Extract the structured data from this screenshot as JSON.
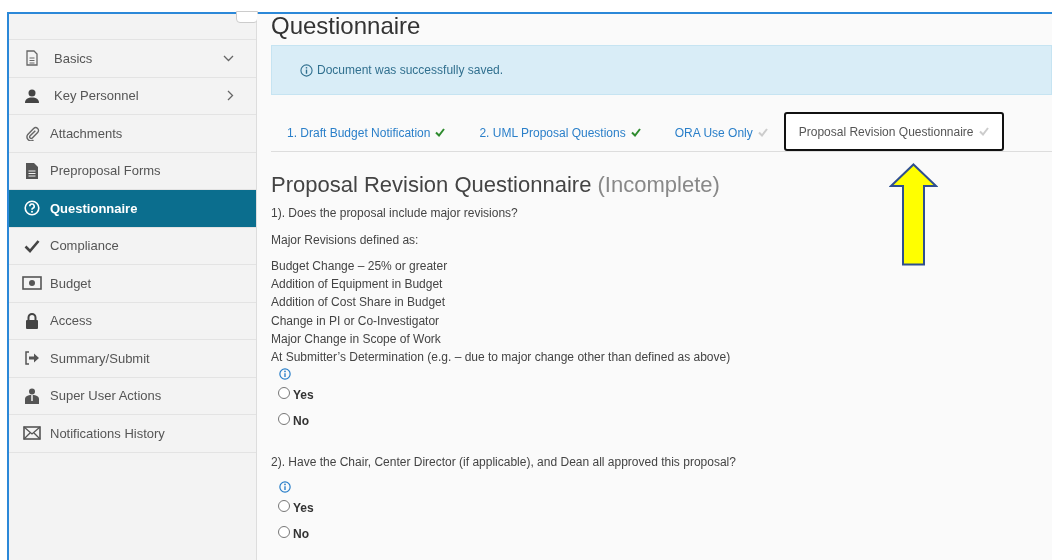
{
  "sidebar": {
    "items": [
      {
        "label": "Basics",
        "kind": "group",
        "expanded": true,
        "selected": false
      },
      {
        "label": "Key Personnel",
        "kind": "group",
        "expanded": false,
        "selected": false
      },
      {
        "label": "Attachments",
        "kind": "link",
        "selected": false
      },
      {
        "label": "Preproposal Forms",
        "kind": "link",
        "selected": false
      },
      {
        "label": "Questionnaire",
        "kind": "link",
        "selected": true
      },
      {
        "label": "Compliance",
        "kind": "link",
        "selected": false
      },
      {
        "label": "Budget",
        "kind": "link",
        "selected": false
      },
      {
        "label": "Access",
        "kind": "link",
        "selected": false
      },
      {
        "label": "Summary/Submit",
        "kind": "link",
        "selected": false
      },
      {
        "label": "Super User Actions",
        "kind": "link",
        "selected": false
      },
      {
        "label": "Notifications History",
        "kind": "link",
        "selected": false
      }
    ]
  },
  "page_title": "Questionnaire",
  "alert": {
    "message": "Document was successfully saved."
  },
  "tabs": [
    {
      "label": "1. Draft Budget Notification",
      "complete": true,
      "selected": false
    },
    {
      "label": "2. UML Proposal Questions",
      "complete": true,
      "selected": false
    },
    {
      "label": "ORA Use Only",
      "complete": false,
      "selected": false
    },
    {
      "label": "Proposal Revision Questionnaire",
      "complete": false,
      "selected": true
    }
  ],
  "section": {
    "title": "Proposal Revision Questionnaire",
    "status": "(Incomplete)"
  },
  "questions": [
    {
      "text": "1). Does the proposal include major revisions?",
      "note": "Major Revisions defined as:",
      "lines": [
        "Budget Change – 25% or greater",
        "Addition of Equipment in Budget",
        "Addition of Cost Share in Budget",
        "Change in PI or Co-Investigator",
        "Major Change in Scope of Work",
        "At Submitter’s Determination (e.g. – due to major change other than defined as above)"
      ],
      "options": [
        {
          "label": "Yes",
          "checked": false
        },
        {
          "label": "No",
          "checked": false
        }
      ]
    },
    {
      "text": "2). Have the Chair, Center Director (if applicable), and Dean all approved this proposal?",
      "options": [
        {
          "label": "Yes",
          "checked": false
        },
        {
          "label": "No",
          "checked": false
        }
      ]
    }
  ]
}
